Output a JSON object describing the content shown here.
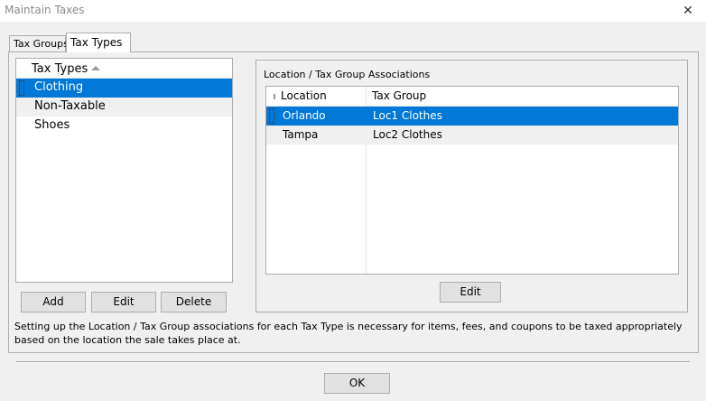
{
  "window": {
    "title": "Maintain Taxes",
    "close_glyph": "✕"
  },
  "tabs": [
    {
      "label": "Tax Groups",
      "selected": false
    },
    {
      "label": "Tax Types",
      "selected": true
    }
  ],
  "tax_types_list": {
    "header": "Tax Types",
    "sort": "ascending",
    "items": [
      {
        "label": "Clothing",
        "selected": true
      },
      {
        "label": "Non-Taxable",
        "selected": false
      },
      {
        "label": "Shoes",
        "selected": false
      }
    ]
  },
  "list_buttons": {
    "add": "Add",
    "edit": "Edit",
    "delete": "Delete"
  },
  "associations": {
    "group_label": "Location / Tax Group Associations",
    "columns": [
      "Location",
      "Tax Group"
    ],
    "rows": [
      {
        "location": "Orlando",
        "tax_group": "Loc1 Clothes",
        "selected": true
      },
      {
        "location": "Tampa",
        "tax_group": "Loc2 Clothes",
        "selected": false
      }
    ],
    "edit_label": "Edit"
  },
  "help_text": "Setting up the Location / Tax Group associations for each Tax Type is necessary for items, fees, and coupons to be taxed appropriately based on the location the sale takes place at.",
  "footer": {
    "ok_label": "OK"
  },
  "colors": {
    "selection": "#0078d7",
    "alt_row": "#f0f0f0",
    "background": "#f0f0f0"
  }
}
